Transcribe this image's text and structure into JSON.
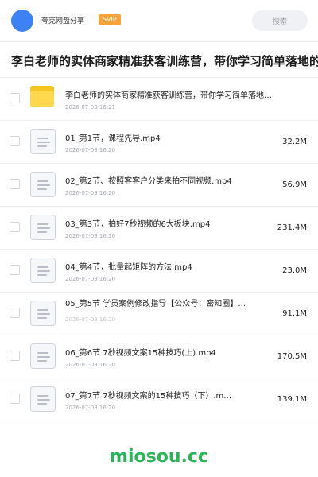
{
  "header": {
    "app_name": "夸克网盘分享",
    "badge": "SVIP",
    "search_label": "搜索",
    "avatar_color": "#3d82f5"
  },
  "share_title": "李白老师的实体商家精准获客训练营，带你学习简单落地的",
  "files": [
    {
      "name": "李白老师的实体商家精准获客训练营，带你学习简单落地…",
      "date": "2026-07-03 16:21",
      "size": "",
      "icon": "folder-icon"
    },
    {
      "name": "01_第1节，课程先导.mp4",
      "date": "2026-07-03 16:20",
      "size": "32.2M",
      "icon": "video-file-icon"
    },
    {
      "name": "02_第2节、按照客客户分类来拍不同视频.mp4",
      "date": "2026-07-03 16:20",
      "size": "56.9M",
      "icon": "video-file-icon"
    },
    {
      "name": "03_第3节，拍好7秒视频的6大板块.mp4",
      "date": "2026-07-03 16:20",
      "size": "231.4M",
      "icon": "video-file-icon"
    },
    {
      "name": "04_第4节，批量起矩阵的方法.mp4",
      "date": "2026-07-03 16:20",
      "size": "23.0M",
      "icon": "video-file-icon"
    },
    {
      "name": "05_第5节 学员案例修改指导【公众号：密知圈】…",
      "date": "2026-07-03 16:20",
      "size": "91.1M",
      "icon": "video-file-icon"
    },
    {
      "name": "06_第6节 7秒视频文案15种技巧(上).mp4",
      "date": "2026-07-03 16:20",
      "size": "170.5M",
      "icon": "video-file-icon"
    },
    {
      "name": "07_第7节 7秒视频文案的15种技巧（下）.m…",
      "date": "2026-07-03 16:20",
      "size": "139.1M",
      "icon": "video-file-icon"
    }
  ],
  "watermark": "miosou.cc",
  "colors": {
    "badge": "#f7a33a",
    "folder": "#ffd84d",
    "watermark": "#2ab55a"
  }
}
